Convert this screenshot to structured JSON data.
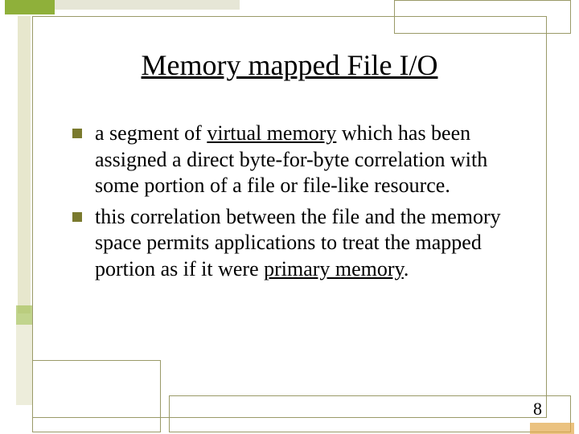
{
  "title": "Memory mapped File I/O",
  "bullets": [
    {
      "pre": "a segment of ",
      "underlined": "virtual memory",
      "post": " which has been assigned a direct byte-for-byte correlation with some portion of a file or file-like resource."
    },
    {
      "pre": "this correlation between the file and the memory space permits applications to treat the mapped portion as if it were ",
      "underlined": "primary memory",
      "post": "."
    }
  ],
  "page_number": "8",
  "colors": {
    "bullet_square": "#7a7a2e",
    "frame": "#9a9a68",
    "accent_green": "#8fb03a",
    "accent_orange": "#e2a84a"
  }
}
